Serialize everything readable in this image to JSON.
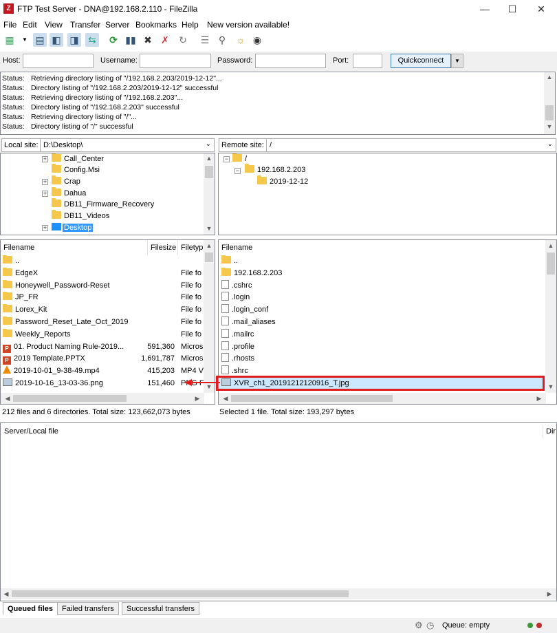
{
  "window": {
    "title": "FTP Test Server - DNA@192.168.2.110 - FileZilla",
    "app_icon": "Z"
  },
  "menu": [
    "File",
    "Edit",
    "View",
    "Transfer",
    "Server",
    "Bookmarks",
    "Help",
    "New version available!"
  ],
  "quickconnect": {
    "host_label": "Host:",
    "username_label": "Username:",
    "password_label": "Password:",
    "port_label": "Port:",
    "button_label": "Quickconnect"
  },
  "log": [
    {
      "k": "Status:",
      "msg": "Retrieving directory listing of \"/192.168.2.203/2019-12-12\"..."
    },
    {
      "k": "Status:",
      "msg": "Directory listing of \"/192.168.2.203/2019-12-12\" successful"
    },
    {
      "k": "Status:",
      "msg": "Retrieving directory listing of \"/192.168.2.203\"..."
    },
    {
      "k": "Status:",
      "msg": "Directory listing of \"/192.168.2.203\" successful"
    },
    {
      "k": "Status:",
      "msg": "Retrieving directory listing of \"/\"..."
    },
    {
      "k": "Status:",
      "msg": "Directory listing of \"/\" successful"
    }
  ],
  "local": {
    "site_label": "Local site:",
    "site_path": "D:\\Desktop\\",
    "tree": [
      "Call_Center",
      "Config.Msi",
      "Crap",
      "Dahua",
      "DB11_Firmware_Recovery",
      "DB11_Videos",
      "Desktop"
    ],
    "columns": [
      "Filename",
      "Filesize",
      "Filetyp"
    ],
    "files": [
      {
        "name": "..",
        "size": "",
        "type": "",
        "icon": "folder"
      },
      {
        "name": "EdgeX",
        "size": "",
        "type": "File fo",
        "icon": "folder"
      },
      {
        "name": "Honeywell_Password-Reset",
        "size": "",
        "type": "File fo",
        "icon": "folder"
      },
      {
        "name": "JP_FR",
        "size": "",
        "type": "File fo",
        "icon": "folder"
      },
      {
        "name": "Lorex_Kit",
        "size": "",
        "type": "File fo",
        "icon": "folder"
      },
      {
        "name": "Password_Reset_Late_Oct_2019",
        "size": "",
        "type": "File fo",
        "icon": "folder"
      },
      {
        "name": "Weekly_Reports",
        "size": "",
        "type": "File fo",
        "icon": "folder"
      },
      {
        "name": "01. Product Naming Rule-2019...",
        "size": "591,360",
        "type": "Micros",
        "icon": "office"
      },
      {
        "name": "2019 Template.PPTX",
        "size": "1,691,787",
        "type": "Micros",
        "icon": "office"
      },
      {
        "name": "2019-10-01_9-38-49.mp4",
        "size": "415,203",
        "type": "MP4 V",
        "icon": "vlc"
      },
      {
        "name": "2019-10-16_13-03-36.png",
        "size": "151,460",
        "type": "PNG F",
        "icon": "image"
      }
    ],
    "status": "212 files and 6 directories. Total size: 123,662,073 bytes"
  },
  "remote": {
    "site_label": "Remote site:",
    "site_path": "/",
    "tree": [
      "/",
      "192.168.2.203",
      "2019-12-12"
    ],
    "columns": [
      "Filename"
    ],
    "files": [
      {
        "name": "..",
        "icon": "folder"
      },
      {
        "name": "192.168.2.203",
        "icon": "folder"
      },
      {
        "name": ".cshrc",
        "icon": "file"
      },
      {
        "name": ".login",
        "icon": "file"
      },
      {
        "name": ".login_conf",
        "icon": "file"
      },
      {
        "name": ".mail_aliases",
        "icon": "file"
      },
      {
        "name": ".mailrc",
        "icon": "file"
      },
      {
        "name": ".profile",
        "icon": "file"
      },
      {
        "name": ".rhosts",
        "icon": "file"
      },
      {
        "name": ".shrc",
        "icon": "file"
      },
      {
        "name": "XVR_ch1_20191212120916_T.jpg",
        "icon": "image"
      }
    ],
    "status": "Selected 1 file. Total size: 193,297 bytes"
  },
  "queue": {
    "col1": "Server/Local file",
    "col2": "Dir"
  },
  "tabs": [
    "Queued files",
    "Failed transfers",
    "Successful transfers"
  ],
  "bottom": {
    "queue_status": "Queue: empty"
  },
  "colors": {
    "highlight": "#e01c1c",
    "selection": "#cce8ff",
    "folder": "#f5c84c"
  }
}
